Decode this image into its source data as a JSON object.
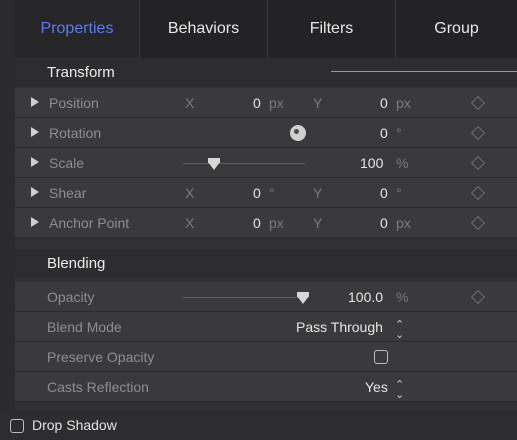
{
  "tabs": [
    {
      "label": "Properties",
      "active": true
    },
    {
      "label": "Behaviors"
    },
    {
      "label": "Filters"
    },
    {
      "label": "Group"
    }
  ],
  "sections": {
    "transform": "Transform",
    "blending": "Blending"
  },
  "transform": {
    "position": {
      "label": "Position",
      "x_label": "X",
      "x_value": "0",
      "x_unit": "px",
      "y_label": "Y",
      "y_value": "0",
      "y_unit": "px"
    },
    "rotation": {
      "label": "Rotation",
      "value": "0",
      "unit": "°"
    },
    "scale": {
      "label": "Scale",
      "value": "100",
      "unit": "%",
      "slider_level": 0.2
    },
    "shear": {
      "label": "Shear",
      "x_label": "X",
      "x_value": "0",
      "x_unit": "°",
      "y_label": "Y",
      "y_value": "0",
      "y_unit": "°"
    },
    "anchor": {
      "label": "Anchor Point",
      "x_label": "X",
      "x_value": "0",
      "x_unit": "px",
      "y_label": "Y",
      "y_value": "0",
      "y_unit": "px"
    }
  },
  "blending": {
    "opacity": {
      "label": "Opacity",
      "value": "100.0",
      "unit": "%",
      "slider_level": 1.0
    },
    "blend_mode": {
      "label": "Blend Mode",
      "value": "Pass Through"
    },
    "preserve_opacity": {
      "label": "Preserve Opacity",
      "checked": false
    },
    "casts_reflection": {
      "label": "Casts Reflection",
      "value": "Yes"
    }
  },
  "drop_shadow": {
    "label": "Drop Shadow",
    "checked": false
  },
  "icons": {
    "disclosure": "disclosure-triangle-icon",
    "keyframe": "keyframe-diamond-icon",
    "rotation_dial": "rotation-dial-icon",
    "stepper": "up-down-chevron-icon"
  },
  "colors": {
    "accent": "#5b7cf5",
    "tab_bar": "#232325",
    "row": "#3a3a3c",
    "section": "#2d2d2f"
  }
}
